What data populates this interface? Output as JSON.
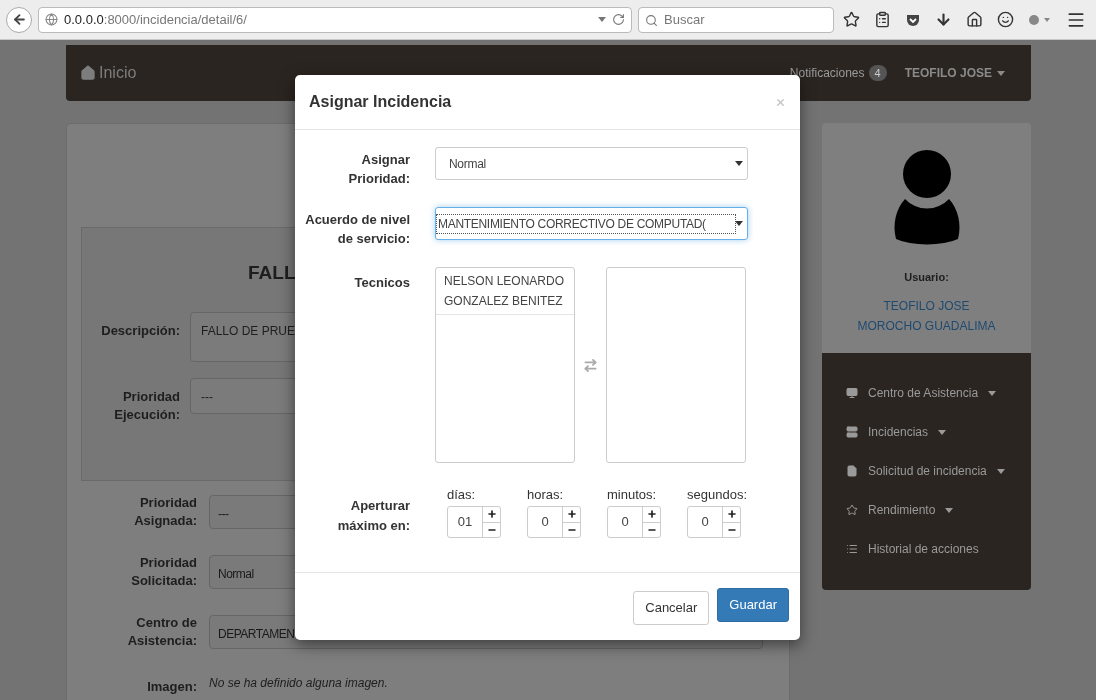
{
  "browser": {
    "url_host": "0.0.0.0",
    "url_path": ":8000/incidencia/detail/6/",
    "search": {
      "placeholder": "Buscar"
    }
  },
  "navbar": {
    "brand": "Inicio",
    "notifications": {
      "label": "Notificaciones",
      "count": "4"
    },
    "user": "TEOFILO JOSE"
  },
  "detail": {
    "title": "FALL",
    "upper_fields": [
      {
        "label": "Descripción:",
        "value": "FALLO DE PRUE",
        "kind": "textarea"
      },
      {
        "label": "Prioridad\nEjecución:",
        "value": "---",
        "kind": "input"
      }
    ],
    "lower_fields": [
      {
        "label": "Prioridad\nAsignada:",
        "value": "---"
      },
      {
        "label": "Prioridad\nSolicitada:",
        "value": "Normal"
      },
      {
        "label": "Centro de\nAsistencia:",
        "value": "DEPARTAMEN"
      }
    ],
    "image": {
      "label": "Imagen:",
      "value": "No se ha definido alguna imagen."
    }
  },
  "modal": {
    "title": "Asignar Incidencia",
    "selects": [
      {
        "label": "Asignar\nPrioridad:",
        "value": "Normal",
        "focused": false
      },
      {
        "label": "Acuerdo de nivel\nde servicio:",
        "value": "MANTENIMIENTO CORRECTIVO DE COMPUTAD(",
        "focused": true
      }
    ],
    "technicians": {
      "label": "Tecnicos",
      "available": [
        "NELSON LEONARDO\nGONZALEZ BENITEZ"
      ]
    },
    "duration": {
      "label": "Aperturar\nmáximo en:",
      "spinners": [
        {
          "label": "días:",
          "value": "01"
        },
        {
          "label": "horas:",
          "value": "0"
        },
        {
          "label": "minutos:",
          "value": "0"
        },
        {
          "label": "segundos:",
          "value": "0"
        }
      ]
    },
    "buttons": [
      {
        "label": "Cancelar",
        "kind": "default"
      },
      {
        "label": "Guardar",
        "kind": "primary"
      }
    ]
  },
  "sidebar": {
    "user_label": "Usuario:",
    "user_name": "TEOFILO JOSE MOROCHO GUADALIMA",
    "menu": [
      {
        "label": "Centro de Asistencia",
        "dropdown": true
      },
      {
        "label": "Incidencias",
        "dropdown": true
      },
      {
        "label": "Solicitud de incidencia",
        "dropdown": true
      },
      {
        "label": "Rendimiento",
        "dropdown": true
      },
      {
        "label": "Historial de acciones",
        "dropdown": false
      }
    ]
  }
}
